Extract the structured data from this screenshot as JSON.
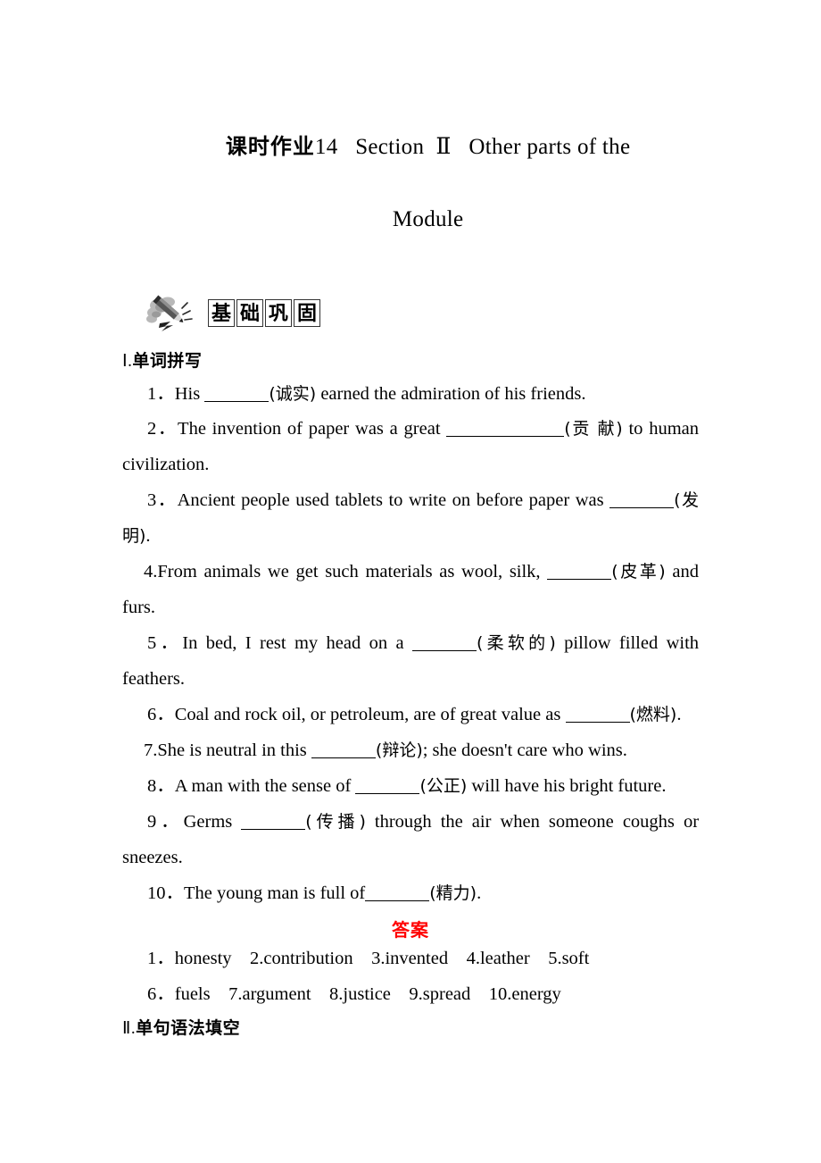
{
  "title": {
    "prefix_cn": "课时作业",
    "number": "14",
    "section": "Section",
    "roman": "Ⅱ",
    "name_line1": "Other parts of the",
    "name_line2": "Module"
  },
  "banner": {
    "icon": "pencil-icon",
    "chars": [
      "基",
      "础",
      "巩",
      "固"
    ]
  },
  "section1": {
    "heading_roman": "Ⅰ",
    "heading_dot": ".",
    "heading_cn": "单词拼写",
    "questions": [
      {
        "num": "1．",
        "before": "His ",
        "blank": "s",
        "hint": "(诚实)",
        "after": " earned the admiration of his friends."
      },
      {
        "num": "2．",
        "before": "The invention of paper was a great ",
        "blank": "l",
        "hint": "(贡 献)",
        "after": " to human civilization."
      },
      {
        "num": "3．",
        "before": "Ancient people used tablets to write on before paper was ",
        "blank": "s",
        "hint": "(发明)",
        "after": "."
      },
      {
        "num": "4.",
        "before": "From animals we get such materials as wool, silk, ",
        "blank": "s",
        "hint": "(皮革)",
        "after": " and furs."
      },
      {
        "num": "5．",
        "before": "In bed, I rest my head on a ",
        "blank": "s",
        "hint": "(柔软的)",
        "after": " pillow filled with feathers."
      },
      {
        "num": "6．",
        "before": "Coal and rock oil, or petroleum, are of great value as ",
        "blank": "s",
        "hint": "(燃料)",
        "after": "."
      },
      {
        "num": "7.",
        "before": "She is neutral in this ",
        "blank": "s",
        "hint": "(辩论)",
        "after": "; she doesn't care who wins."
      },
      {
        "num": "8．",
        "before": "A man with the sense of ",
        "blank": "s",
        "hint": "(公正)",
        "after": " will have his bright future."
      },
      {
        "num": "9．",
        "before": "Germs ",
        "blank": "s",
        "hint": "(传播)",
        "after": " through the air when someone coughs or sneezes."
      },
      {
        "num": "10．",
        "before": "The young man is full of",
        "blank": "s",
        "hint": "(精力)",
        "after": "."
      }
    ],
    "answer_label": "答案",
    "answers_line1": "1．honesty　2.contribution　3.invented　4.leather　5.soft",
    "answers_line2": "6．fuels　7.argument　8.justice　9.spread　10.energy"
  },
  "section2": {
    "heading_roman": "Ⅱ",
    "heading_dot": ".",
    "heading_cn": "单句语法填空"
  }
}
